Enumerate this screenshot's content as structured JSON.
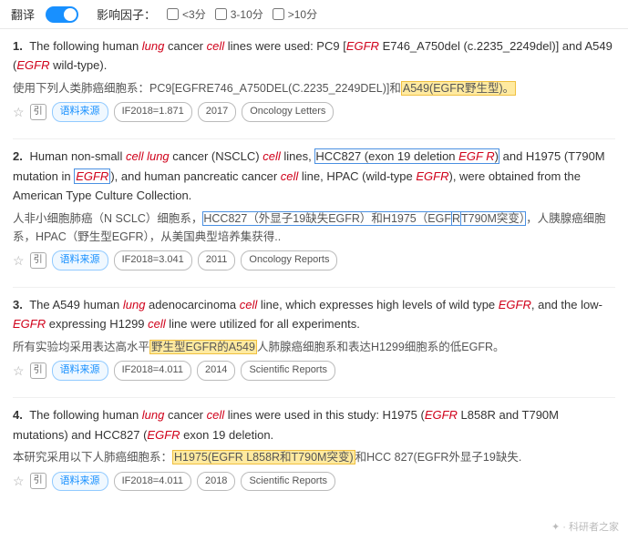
{
  "topbar": {
    "translate_label": "翻译",
    "influence_label": "影响因子：",
    "filter1": "<3分",
    "filter2": "3-10分",
    "filter3": ">10分"
  },
  "results": [
    {
      "number": "1.",
      "en_text_parts": [
        {
          "text": "The following human ",
          "type": "normal"
        },
        {
          "text": "lung",
          "type": "italic"
        },
        {
          "text": " cancer ",
          "type": "normal"
        },
        {
          "text": "cell",
          "type": "italic"
        },
        {
          "text": " lines were used: PC9 [",
          "type": "normal"
        },
        {
          "text": "EGFR",
          "type": "red-italic"
        },
        {
          "text": " E746_A750del (c.2235_2249del)] and A549 (",
          "type": "normal"
        },
        {
          "text": "EGFR",
          "type": "red-italic"
        },
        {
          "text": " wild-type).",
          "type": "normal"
        }
      ],
      "cn_text": "使用下列人类肺癌细胞系：PC9[EGFRE746_A750DEL(C.2235_2249DEL)]和",
      "cn_highlight": "A549(EGFR野生型)。",
      "cn_after": "",
      "tags": [
        "语料来源",
        "IF2018=1.871",
        "2017",
        "Oncology Letters"
      ],
      "tag_types": [
        "source",
        "normal",
        "normal",
        "normal"
      ]
    },
    {
      "number": "2.",
      "en_text_parts": [
        {
          "text": "Human non-small ",
          "type": "normal"
        },
        {
          "text": "cell lung",
          "type": "italic"
        },
        {
          "text": " cancer (NSCLC) ",
          "type": "normal"
        },
        {
          "text": "cell",
          "type": "italic"
        },
        {
          "text": " lines, ",
          "type": "normal"
        },
        {
          "text": "HCC827 (exon 19 deletion EGF R)",
          "type": "highlight-blue"
        },
        {
          "text": " and ",
          "type": "normal"
        },
        {
          "text": "H1975 (T790M mutation in ",
          "type": "normal"
        },
        {
          "text": "EGFR",
          "type": "egfr-box"
        },
        {
          "text": "), and human pancreatic cancer ",
          "type": "normal"
        },
        {
          "text": "cell",
          "type": "italic"
        },
        {
          "text": " line, HPAC (wild-type ",
          "type": "normal"
        },
        {
          "text": "EGFR",
          "type": "red-italic"
        },
        {
          "text": "), were obtained from the American Type Culture Collection.",
          "type": "normal"
        }
      ],
      "cn_text": "人非小细胞肺癌（N SCLC）细胞系，",
      "cn_highlight": "HCC827（外显子19缺失EGFR）和H1975（EGFR",
      "cn_highlight2": "T790M突变）",
      "cn_after": "，人胰腺癌细胞系，HPAC（野生型EGFR），从美国典型培养集获得..",
      "tags": [
        "语料来源",
        "IF2018=3.041",
        "2011",
        "Oncology Reports"
      ],
      "tag_types": [
        "source",
        "normal",
        "normal",
        "normal"
      ]
    },
    {
      "number": "3.",
      "en_text_parts": [
        {
          "text": "The A549 human ",
          "type": "normal"
        },
        {
          "text": "lung",
          "type": "italic"
        },
        {
          "text": " adenocarcinoma ",
          "type": "normal"
        },
        {
          "text": "cell",
          "type": "italic"
        },
        {
          "text": " line, which expresses high levels of wild type ",
          "type": "normal"
        },
        {
          "text": "EGFR",
          "type": "red-italic"
        },
        {
          "text": ", and the low-",
          "type": "normal"
        },
        {
          "text": "EGFR",
          "type": "red-italic"
        },
        {
          "text": " expressing H1299 ",
          "type": "normal"
        },
        {
          "text": "cell",
          "type": "italic"
        },
        {
          "text": " line were utilized for all experiments.",
          "type": "normal"
        }
      ],
      "cn_text": "所有实验均采用表达高水平",
      "cn_highlight": "野生型EGFR的A549",
      "cn_after": "人肺腺癌细胞系和表达H1299细胞系的低EGFR。",
      "tags": [
        "语料来源",
        "IF2018=4.011",
        "2014",
        "Scientific Reports"
      ],
      "tag_types": [
        "source",
        "normal",
        "normal",
        "normal"
      ]
    },
    {
      "number": "4.",
      "en_text_parts": [
        {
          "text": "The following human ",
          "type": "normal"
        },
        {
          "text": "lung",
          "type": "italic"
        },
        {
          "text": " cancer ",
          "type": "normal"
        },
        {
          "text": "cell",
          "type": "italic"
        },
        {
          "text": " lines were used in this study: H1975 (",
          "type": "normal"
        },
        {
          "text": "EGFR",
          "type": "red-italic"
        },
        {
          "text": " L858R and T790M mutations) and HCC827 (",
          "type": "normal"
        },
        {
          "text": "EGFR",
          "type": "red-italic"
        },
        {
          "text": " exon 19 deletion.",
          "type": "normal"
        }
      ],
      "cn_text": "本研究采用以下人肺癌细胞系：",
      "cn_highlight": "H1975(EGFR L858R和T790M突变)",
      "cn_after": "和HCC 827(EGFR外显子19缺失.",
      "tags": [
        "语料来源",
        "IF2018=4.011",
        "2018",
        "Scientific Reports"
      ],
      "tag_types": [
        "source",
        "normal",
        "normal",
        "normal"
      ]
    }
  ],
  "watermark": "· 科研者之家"
}
